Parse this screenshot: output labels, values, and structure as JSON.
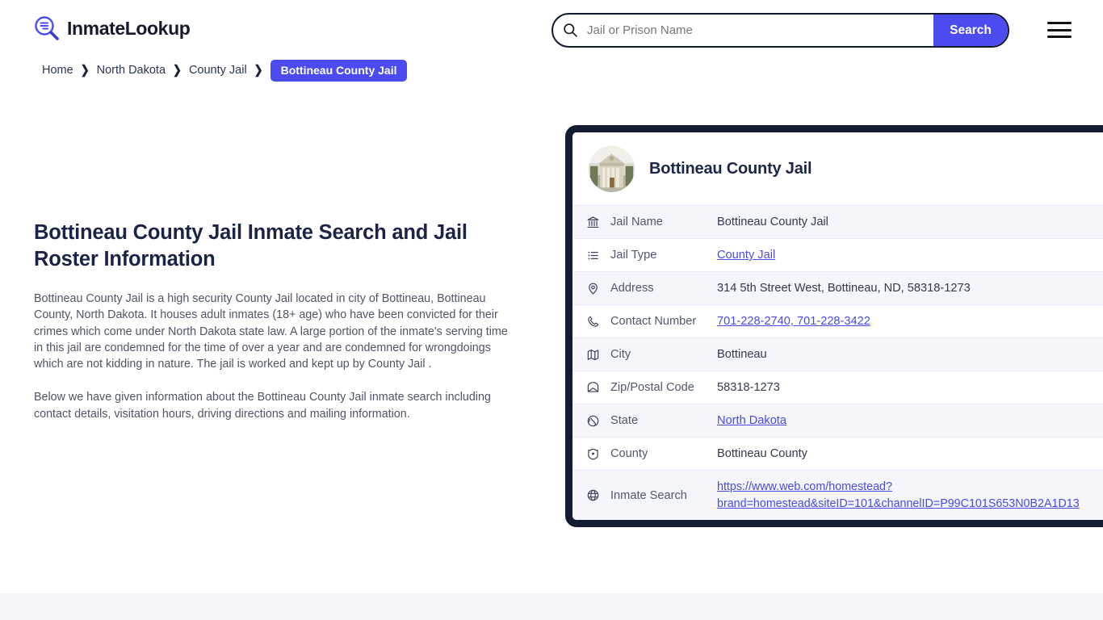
{
  "header": {
    "brand_name": "InmateLookup",
    "brand_icon": "magnifier-list-icon",
    "menu_icon": "hamburger-menu-icon",
    "search": {
      "icon": "search-icon",
      "placeholder": "Jail or Prison Name",
      "value": "",
      "button_label": "Search"
    },
    "accent_color": "#4b4bf0"
  },
  "breadcrumb": {
    "items": [
      {
        "label": "Home",
        "current": false
      },
      {
        "label": "North Dakota",
        "current": false
      },
      {
        "label": "County Jail",
        "current": false
      },
      {
        "label": "Bottineau County Jail",
        "current": true
      }
    ],
    "separator": "❯"
  },
  "main": {
    "title": "Bottineau County Jail Inmate Search and Jail Roster Information",
    "paragraphs": [
      "Bottineau County Jail is a high security County Jail located in city of Bottineau, Bottineau County, North Dakota. It houses adult inmates (18+ age) who have been convicted for their crimes which come under North Dakota state law. A large portion of the inmate's serving time in this jail are condemned for the time of over a year and are condemned for wrongdoings which are not kidding in nature. The jail is worked and kept up by County Jail .",
      "Below we have given information about the Bottineau County Jail inmate search including contact details, visitation hours, driving directions and mailing information."
    ]
  },
  "info_card": {
    "thumbnail_icon": "courthouse-photo",
    "title": "Bottineau County Jail",
    "rows": [
      {
        "icon": "bank-building-icon",
        "label": "Jail Name",
        "value": "Bottineau County Jail",
        "link": false
      },
      {
        "icon": "list-icon",
        "label": "Jail Type",
        "value": "County Jail",
        "link": true
      },
      {
        "icon": "map-pin-icon",
        "label": "Address",
        "value": "314 5th Street West, Bottineau, ND, 58318-1273",
        "link": false
      },
      {
        "icon": "phone-icon",
        "label": "Contact Number",
        "value": "701-228-2740, 701-228-3422",
        "link": true
      },
      {
        "icon": "map-icon",
        "label": "City",
        "value": "Bottineau",
        "link": false
      },
      {
        "icon": "envelope-icon",
        "label": "Zip/Postal Code",
        "value": "58318-1273",
        "link": false
      },
      {
        "icon": "globe-icon",
        "label": "State",
        "value": "North Dakota",
        "link": true
      },
      {
        "icon": "shield-icon",
        "label": "County",
        "value": "Bottineau County",
        "link": false
      },
      {
        "icon": "globe-grid-icon",
        "label": "Inmate Search",
        "value": "https://www.web.com/homestead?brand=homestead&siteID=101&channelID=P99C101S653N0B2A1D13",
        "link": true
      }
    ]
  },
  "colors": {
    "accent": "#4b4bf0",
    "card_border": "#131c33",
    "row_alt": "#f5f5fc",
    "link": "#4a4ae0",
    "heading": "#1b2446"
  }
}
